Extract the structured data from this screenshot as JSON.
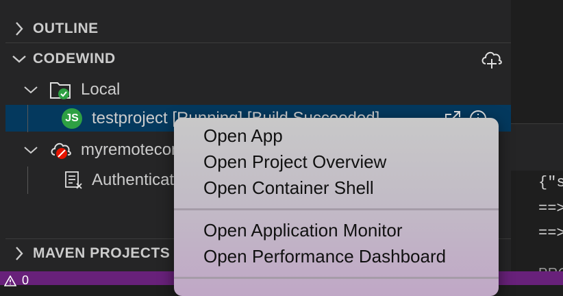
{
  "sidebar": {
    "outline": {
      "label": "OUTLINE"
    },
    "codewind": {
      "label": "CODEWIND",
      "add_connection_icon": "cloud-plus-icon",
      "local": {
        "label": "Local",
        "project": {
          "badge": "JS",
          "label": "testproject [Running] [Build Succeeded]"
        }
      },
      "remote": {
        "label": "myremoteconnection",
        "child_label": "Authentication"
      }
    },
    "maven": {
      "label": "MAVEN PROJECTS"
    }
  },
  "right_panel": {
    "tab": "PRO",
    "code_lines": [
      "{\"s",
      "==>",
      "==>"
    ]
  },
  "status_bar": {
    "warnings": "0"
  },
  "context_menu": {
    "group1": [
      "Open App",
      "Open Project Overview",
      "Open Container Shell"
    ],
    "group2": [
      "Open Application Monitor",
      "Open Performance Dashboard"
    ]
  }
}
